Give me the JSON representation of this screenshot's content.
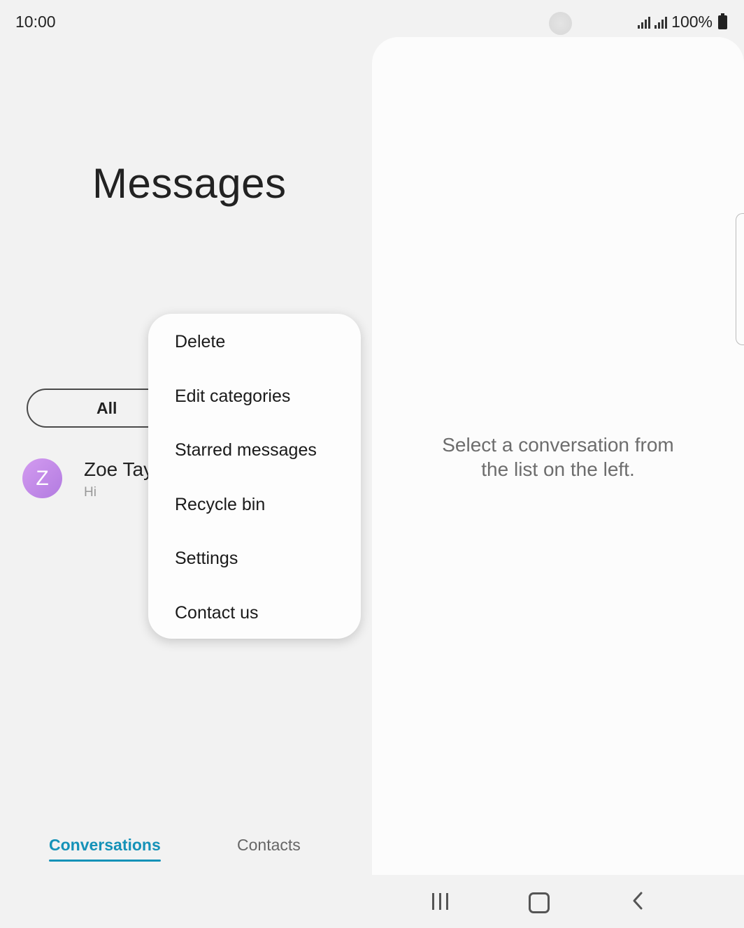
{
  "status": {
    "time": "10:00",
    "battery": "100%"
  },
  "header": {
    "title": "Messages"
  },
  "filter": {
    "label": "All"
  },
  "conversation": {
    "avatar_letter": "Z",
    "name": "Zoe Tay",
    "snippet": "Hi",
    "avatar_color": "#c48ae8"
  },
  "menu": {
    "items": [
      {
        "label": "Delete"
      },
      {
        "label": "Edit categories"
      },
      {
        "label": "Starred messages"
      },
      {
        "label": "Recycle bin"
      },
      {
        "label": "Settings"
      },
      {
        "label": "Contact us"
      }
    ]
  },
  "tabs": {
    "conversations": "Conversations",
    "contacts": "Contacts",
    "active": "Conversations",
    "accent_color": "#1592b8"
  },
  "detail": {
    "empty_text_line1": "Select a conversation from",
    "empty_text_line2": "the list on the left."
  },
  "navigation": {
    "recent_icon": "recent-apps-icon",
    "home_icon": "home-icon",
    "back_icon": "back-icon"
  }
}
